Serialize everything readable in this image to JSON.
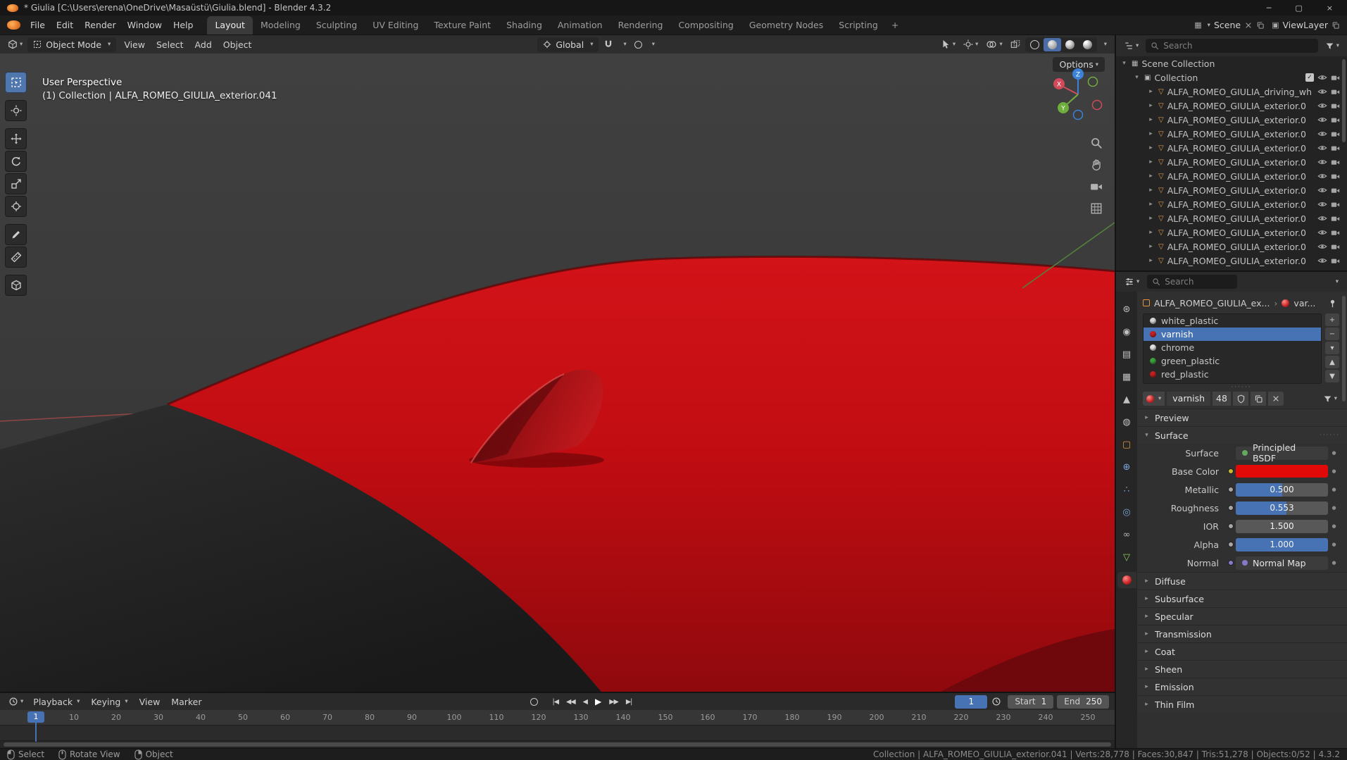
{
  "titlebar": {
    "title": "* Giulia [C:\\Users\\erena\\OneDrive\\Masaüstü\\Giulia.blend] - Blender 4.3.2"
  },
  "icons": {
    "dropdown": "▾",
    "disclosure_open": "▾",
    "disclosure_closed": "▸",
    "breadcrumb_separator": "›",
    "mesh": "▽",
    "scene_collection": "▦",
    "collection": "▣",
    "scene": "▦",
    "view_layer": "▣",
    "check": "✓",
    "plus": "+",
    "minus": "−",
    "move_up": "▲",
    "move_down": "▼",
    "close": "×",
    "minimize": "─",
    "maximize": "▢",
    "decorator_dot": "●",
    "grip": "······",
    "transport": [
      "|◀",
      "◀◀",
      "◀",
      "▶",
      "▶▶",
      "▶|"
    ]
  },
  "topbar": {
    "menus": [
      "File",
      "Edit",
      "Render",
      "Window",
      "Help"
    ],
    "tabs": [
      "Layout",
      "Modeling",
      "Sculpting",
      "UV Editing",
      "Texture Paint",
      "Shading",
      "Animation",
      "Rendering",
      "Compositing",
      "Geometry Nodes",
      "Scripting"
    ],
    "active_tab": "Layout",
    "new_tab_label": "+",
    "scene": {
      "label": "Scene"
    },
    "view_layer": {
      "label": "ViewLayer"
    }
  },
  "viewport": {
    "header": {
      "mode": "Object Mode",
      "menus": [
        "View",
        "Select",
        "Add",
        "Object"
      ],
      "orientation": "Global",
      "options_label": "Options"
    },
    "overlay": {
      "line1": "User Perspective",
      "line2": "(1) Collection | ALFA_ROMEO_GIULIA_exterior.041"
    },
    "tools": [
      "select-box",
      "cursor",
      "move",
      "rotate",
      "scale",
      "transform",
      "annotate",
      "measure",
      "add-cube"
    ],
    "active_tool": "select-box",
    "nav_icons": [
      "zoom",
      "pan",
      "camera-view",
      "toggle-projection"
    ],
    "gizmo_axes": [
      "X",
      "Y",
      "Z"
    ]
  },
  "outliner": {
    "search_placeholder": "Search",
    "root": "Scene Collection",
    "collection": "Collection",
    "items": [
      "ALFA_ROMEO_GIULIA_driving_wh",
      "ALFA_ROMEO_GIULIA_exterior.0",
      "ALFA_ROMEO_GIULIA_exterior.0",
      "ALFA_ROMEO_GIULIA_exterior.0",
      "ALFA_ROMEO_GIULIA_exterior.0",
      "ALFA_ROMEO_GIULIA_exterior.0",
      "ALFA_ROMEO_GIULIA_exterior.0",
      "ALFA_ROMEO_GIULIA_exterior.0",
      "ALFA_ROMEO_GIULIA_exterior.0",
      "ALFA_ROMEO_GIULIA_exterior.0",
      "ALFA_ROMEO_GIULIA_exterior.0",
      "ALFA_ROMEO_GIULIA_exterior.0",
      "ALFA_ROMEO_GIULIA_exterior.0"
    ]
  },
  "properties": {
    "search_placeholder": "Search",
    "active_tab": "material",
    "tabs": [
      {
        "name": "tool",
        "glyph": "⊛",
        "color": "#c0c0c0"
      },
      {
        "name": "render",
        "glyph": "◉",
        "color": "#c0c0c0"
      },
      {
        "name": "output",
        "glyph": "▤",
        "color": "#c0c0c0"
      },
      {
        "name": "view-layer",
        "glyph": "▦",
        "color": "#c0c0c0"
      },
      {
        "name": "scene",
        "glyph": "▲",
        "color": "#c0c0c0"
      },
      {
        "name": "world",
        "glyph": "◍",
        "color": "#c0c0c0"
      },
      {
        "name": "object",
        "glyph": "▢",
        "color": "#e8953f"
      },
      {
        "name": "modifiers",
        "glyph": "⊕",
        "color": "#7aa5d8"
      },
      {
        "name": "particles",
        "glyph": "∴",
        "color": "#7aa5d8"
      },
      {
        "name": "physics",
        "glyph": "◎",
        "color": "#7aa5d8"
      },
      {
        "name": "constraints",
        "glyph": "∞",
        "color": "#b5b5b5"
      },
      {
        "name": "object-data",
        "glyph": "▽",
        "color": "#8fce5f"
      },
      {
        "name": "material",
        "glyph": null,
        "color": "#cc2222"
      }
    ],
    "breadcrumb": {
      "object": "ALFA_ROMEO_GIULIA_ex...",
      "material": "var..."
    },
    "slots": [
      {
        "name": "white_plastic",
        "color": "#d8d8d8",
        "selected": false
      },
      {
        "name": "varnish",
        "color": "#c42020",
        "selected": true
      },
      {
        "name": "chrome",
        "color": "#e2e2e2",
        "selected": false
      },
      {
        "name": "green_plastic",
        "color": "#3da13d",
        "selected": false
      },
      {
        "name": "red_plastic",
        "color": "#c42020",
        "selected": false
      }
    ],
    "datablock": {
      "name": "varnish",
      "users": "48"
    },
    "panels_collapsed_top": [
      "Preview"
    ],
    "surface": {
      "title": "Surface",
      "rows": [
        {
          "label": "Surface",
          "type": "node",
          "value": "Principled BSDF",
          "dot": "#63a95e"
        },
        {
          "label": "Base Color",
          "type": "color",
          "value": "#e20909",
          "socket": "#c8b832"
        },
        {
          "label": "Metallic",
          "type": "slider",
          "value": "0.500",
          "fill": 0.5,
          "socket": "#a6a6a6"
        },
        {
          "label": "Roughness",
          "type": "slider",
          "value": "0.553",
          "fill": 0.553,
          "socket": "#a6a6a6"
        },
        {
          "label": "IOR",
          "type": "number",
          "value": "1.500",
          "socket": "#a6a6a6"
        },
        {
          "label": "Alpha",
          "type": "slider",
          "value": "1.000",
          "fill": 1,
          "socket": "#a6a6a6"
        },
        {
          "label": "Normal",
          "type": "node",
          "value": "Normal Map",
          "dot": "#8878c8",
          "socket": "#8878c8"
        }
      ]
    },
    "panels_collapsed": [
      "Diffuse",
      "Subsurface",
      "Specular",
      "Transmission",
      "Coat",
      "Sheen",
      "Emission",
      "Thin Film"
    ]
  },
  "timeline": {
    "menus": [
      "Playback",
      "Keying",
      "View",
      "Marker"
    ],
    "current_frame": "1",
    "playhead_frame": 1,
    "start_label": "Start",
    "start": "1",
    "end_label": "End",
    "end": "250",
    "ticks": [
      10,
      20,
      30,
      40,
      50,
      60,
      70,
      80,
      90,
      100,
      110,
      120,
      130,
      140,
      150,
      160,
      170,
      180,
      190,
      200,
      210,
      220,
      230,
      240,
      250
    ]
  },
  "statusbar": {
    "hints": [
      {
        "button": "left",
        "label": "Select"
      },
      {
        "button": "middle",
        "label": "Rotate View"
      },
      {
        "button": "right",
        "label": "Object"
      }
    ],
    "stats": [
      "Collection",
      "ALFA_ROMEO_GIULIA_exterior.041",
      "Verts:28,778",
      "Faces:30,847",
      "Tris:51,278",
      "Objects:0/52",
      "4.3.2"
    ]
  },
  "colors": {
    "accent": "#4772b3",
    "car_red": "#c20d12",
    "car_dark_red": "#6e080c",
    "object_orange": "#e8953f"
  }
}
